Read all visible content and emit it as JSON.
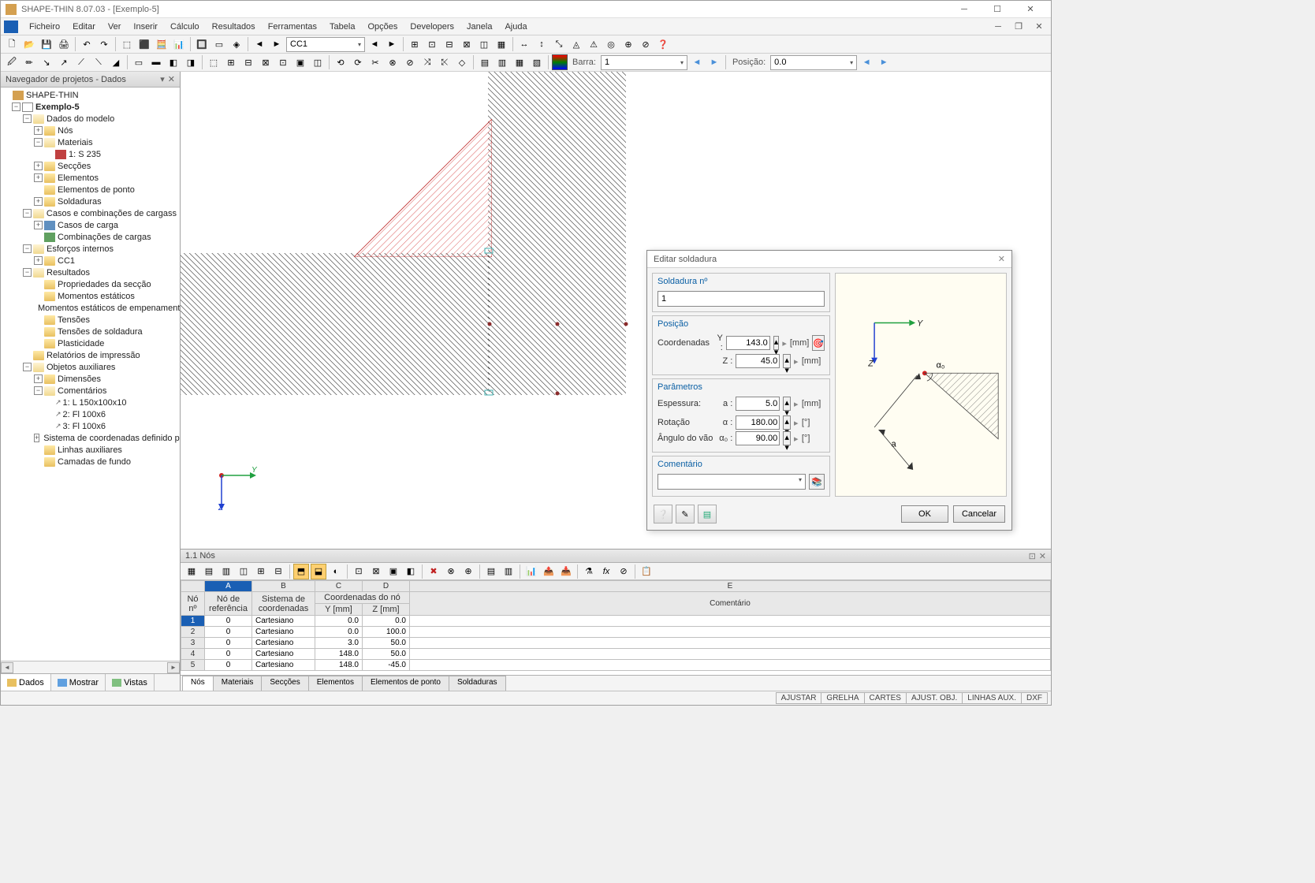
{
  "title": "SHAPE-THIN 8.07.03 - [Exemplo-5]",
  "menubar": [
    "Ficheiro",
    "Editar",
    "Ver",
    "Inserir",
    "Cálculo",
    "Resultados",
    "Ferramentas",
    "Tabela",
    "Opções",
    "Developers",
    "Janela",
    "Ajuda"
  ],
  "toolbar1": {
    "combo_cc": "CC1"
  },
  "toolbar3": {
    "barra_label": "Barra:",
    "barra_value": "1",
    "posicao_label": "Posição:",
    "posicao_value": "0.0"
  },
  "sidebar": {
    "title": "Navegador de projetos - Dados",
    "root": "SHAPE-THIN",
    "project": "Exemplo-5",
    "groups": {
      "dados_modelo": {
        "label": "Dados do modelo",
        "children": {
          "nos": "Nós",
          "materiais": {
            "label": "Materiais",
            "child": "1: S 235"
          },
          "seccoes": "Secções",
          "elementos": "Elementos",
          "elem_ponto": "Elementos de ponto",
          "soldaduras": "Soldaduras"
        }
      },
      "casos": {
        "label": "Casos e combinações de cargass",
        "children": {
          "casos_carga": "Casos de carga",
          "comb_cargas": "Combinações de cargas"
        }
      },
      "esforcos": {
        "label": "Esforços internos",
        "children": {
          "cc1": "CC1"
        }
      },
      "resultados": {
        "label": "Resultados",
        "children": {
          "prop_seccao": "Propriedades da secção",
          "mom_estaticos": "Momentos estáticos",
          "mom_emp": "Momentos estáticos de empenament",
          "tensoes": "Tensões",
          "tensoes_sold": "Tensões de soldadura",
          "plasticidade": "Plasticidade"
        }
      },
      "rel_impressao": "Relatórios de impressão",
      "obj_aux": {
        "label": "Objetos auxiliares",
        "children": {
          "dimensoes": "Dimensões",
          "comentarios": {
            "label": "Comentários",
            "children": {
              "c1": "1: L 150x100x10",
              "c2": "2: Fl 100x6",
              "c3": "3: Fl 100x6"
            }
          },
          "sist_coord": "Sistema de coordenadas definido pel",
          "linhas_aux": "Linhas auxiliares",
          "camadas": "Camadas de fundo"
        }
      }
    },
    "tabs": [
      "Dados",
      "Mostrar",
      "Vistas"
    ]
  },
  "canvas": {
    "axis_y": "Y",
    "axis_z": "Z"
  },
  "dialog": {
    "title": "Editar soldadura",
    "g_num": {
      "legend": "Soldadura nº",
      "value": "1"
    },
    "g_pos": {
      "legend": "Posição",
      "coord_label": "Coordenadas",
      "y_label": "Y :",
      "y_val": "143.0",
      "y_unit": "[mm]",
      "z_label": "Z :",
      "z_val": "45.0",
      "z_unit": "[mm]"
    },
    "g_param": {
      "legend": "Parâmetros",
      "esp_label": "Espessura:",
      "esp_sym": "a :",
      "esp_val": "5.0",
      "esp_unit": "[mm]",
      "rot_label": "Rotação",
      "rot_sym": "α :",
      "rot_val": "180.00",
      "rot_unit": "[°]",
      "ang_label": "Ângulo do vão",
      "ang_sym": "α₀ :",
      "ang_val": "90.00",
      "ang_unit": "[°]"
    },
    "g_comment": {
      "legend": "Comentário",
      "value": ""
    },
    "diagram": {
      "y": "Y",
      "z": "Z",
      "alpha0": "α₀",
      "a": "a"
    },
    "ok": "OK",
    "cancel": "Cancelar"
  },
  "bottom": {
    "title": "1.1 Nós",
    "columns": {
      "no": {
        "head1": "Nó",
        "head2": "nº"
      },
      "ref": {
        "letter": "A",
        "head1": "Nó de",
        "head2": "referência"
      },
      "sist": {
        "letter": "B",
        "head1": "Sistema de",
        "head2": "coordenadas"
      },
      "coord": {
        "head": "Coordenadas do nó",
        "y_letter": "C",
        "y": "Y [mm]",
        "z_letter": "D",
        "z": "Z [mm]"
      },
      "comment": {
        "letter": "E",
        "head": "Comentário"
      }
    },
    "rows": [
      {
        "n": "1",
        "ref": "0",
        "sist": "Cartesiano",
        "y": "0.0",
        "z": "0.0"
      },
      {
        "n": "2",
        "ref": "0",
        "sist": "Cartesiano",
        "y": "0.0",
        "z": "100.0"
      },
      {
        "n": "3",
        "ref": "0",
        "sist": "Cartesiano",
        "y": "3.0",
        "z": "50.0"
      },
      {
        "n": "4",
        "ref": "0",
        "sist": "Cartesiano",
        "y": "148.0",
        "z": "50.0"
      },
      {
        "n": "5",
        "ref": "0",
        "sist": "Cartesiano",
        "y": "148.0",
        "z": "-45.0"
      }
    ],
    "tabs": [
      "Nós",
      "Materiais",
      "Secções",
      "Elementos",
      "Elementos de ponto",
      "Soldaduras"
    ]
  },
  "statusbar": [
    "AJUSTAR",
    "GRELHA",
    "CARTES",
    "AJUST. OBJ.",
    "LINHAS AUX.",
    "DXF"
  ]
}
